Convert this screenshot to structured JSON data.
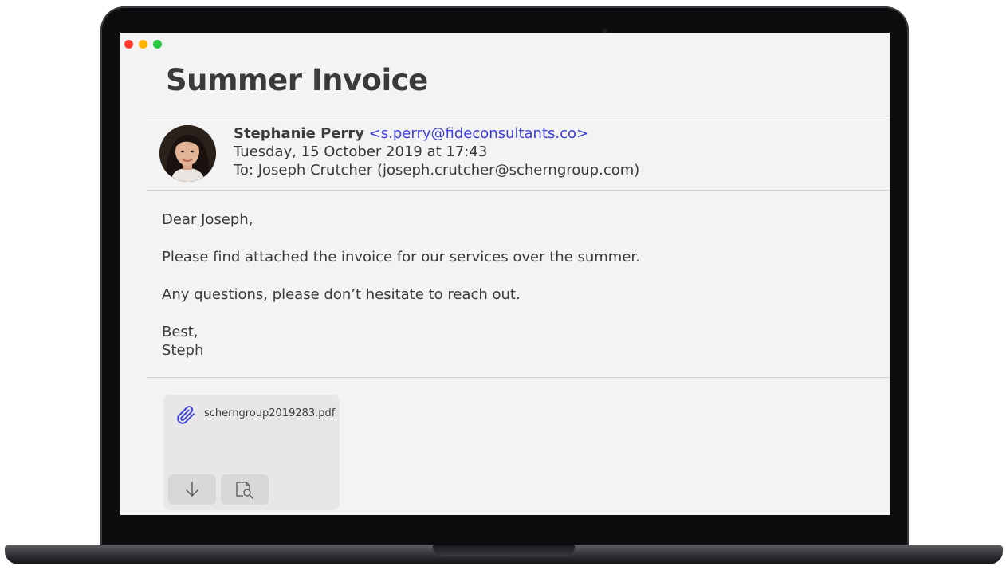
{
  "email": {
    "subject": "Summer Invoice",
    "sender_name": "Stephanie Perry",
    "sender_email": "<s.perry@fideconsultants.co>",
    "date": "Tuesday, 15 October 2019 at 17:43",
    "to": "To: Joseph Crutcher (joseph.crutcher@scherngroup.com)",
    "body": {
      "greeting": "Dear Joseph,",
      "line1": "Please find attached the invoice for our services over the summer.",
      "line2": "Any questions, please don’t hesitate to reach out.",
      "signoff": "Best,",
      "signature": "Steph"
    },
    "attachment": {
      "file_name": "scherngroup2019283.pdf"
    }
  },
  "icons": {
    "attachment": "paperclip-icon",
    "download": "download-arrow-icon",
    "preview": "quick-look-icon"
  },
  "colors": {
    "link": "#3b3fd6",
    "close": "#ff3b30",
    "minimize": "#ffb300",
    "maximize": "#28c840"
  }
}
